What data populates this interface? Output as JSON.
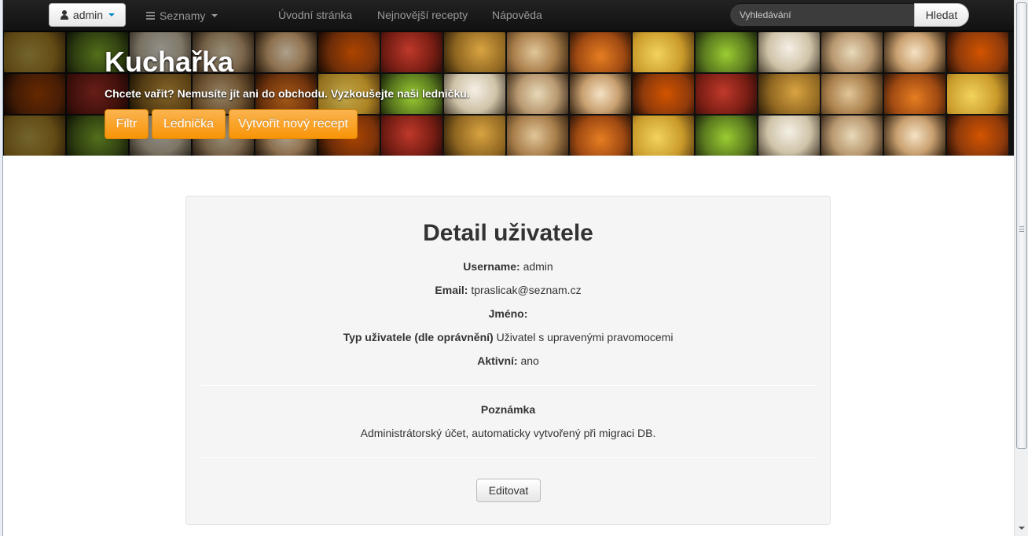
{
  "navbar": {
    "user_menu": "admin",
    "lists_menu": "Seznamy",
    "links": [
      "Úvodní stránka",
      "Nejnovější recepty",
      "Nápověda"
    ],
    "search_placeholder": "Vyhledávání",
    "search_button": "Hledat"
  },
  "hero": {
    "title": "Kuchařka",
    "subtitle": "Chcete vařit? Nemusíte jít ani do obchodu. Vyzkoušejte naši ledničku.",
    "buttons": [
      "Filtr",
      "Lednička",
      "Vytvořit nový recept"
    ]
  },
  "detail": {
    "title": "Detail uživatele",
    "username_label": "Username:",
    "username": "admin",
    "email_label": "Email:",
    "email": "tpraslicak@seznam.cz",
    "name_label": "Jméno:",
    "name": "",
    "type_label": "Typ uživatele (dle oprávnění)",
    "type": "Uživatel s upravenými pravomocemi",
    "active_label": "Aktivní:",
    "active": "ano",
    "note_label": "Poznámka",
    "note": "Administrátorský účet, automaticky vytvořený při migraci DB.",
    "edit_button": "Editovat"
  },
  "colors": {
    "accent": "#f89406",
    "navbar": "#1b1b1b",
    "card_bg": "#f5f5f5"
  }
}
